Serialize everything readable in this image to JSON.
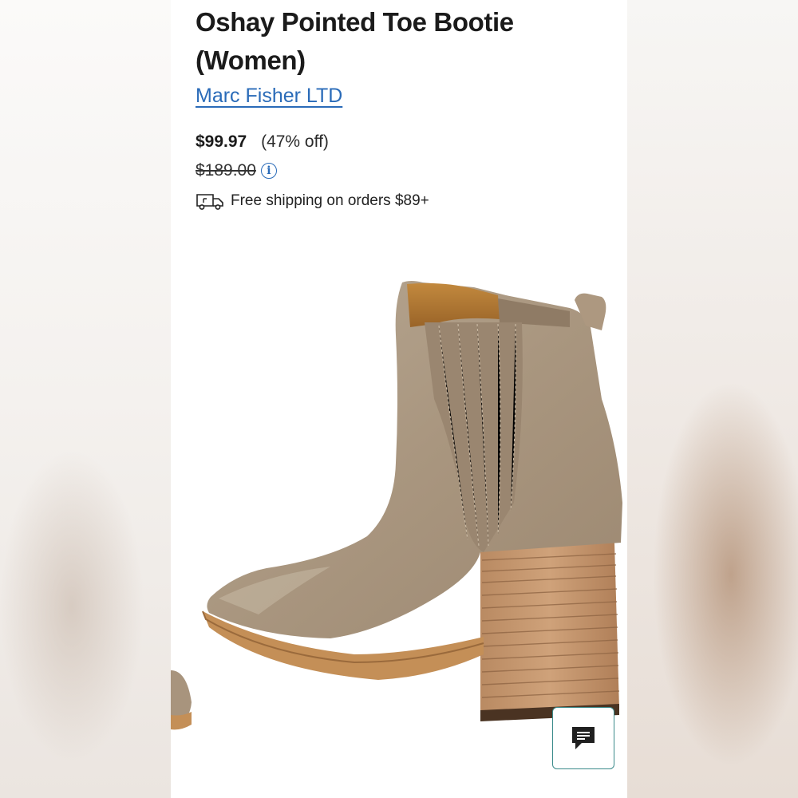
{
  "product": {
    "title": "Oshay Pointed Toe Bootie (Women)",
    "brand": "Marc Fisher LTD",
    "price": "$99.97",
    "discount": "(47% off)",
    "original_price": "$189.00",
    "shipping": "Free shipping on orders $89+"
  },
  "icons": {
    "info": "info-icon",
    "shipping": "truck-icon",
    "chat": "chat-icon"
  },
  "colors": {
    "brand_link": "#2a6bb8",
    "chat_border": "#3a8a8a"
  }
}
